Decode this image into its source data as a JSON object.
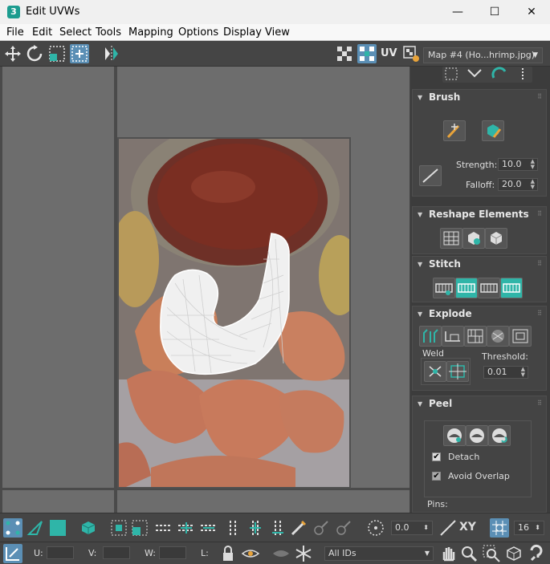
{
  "window": {
    "app_icon_text": "3",
    "title": "Edit UVWs",
    "minimize": "—",
    "maximize": "☐",
    "close": "✕"
  },
  "menu": [
    "File",
    "Edit",
    "Select",
    "Tools",
    "Mapping",
    "Options",
    "Display",
    "View"
  ],
  "toolbar": {
    "uv_label": "UV",
    "map_selected": "Map #4 (Ho...hrimp.jpg)"
  },
  "panel": {
    "brush": {
      "title": "Brush",
      "strength_label": "Strength:",
      "strength_value": "10.0",
      "falloff_label": "Falloff:",
      "falloff_value": "20.0"
    },
    "reshape": {
      "title": "Reshape Elements"
    },
    "stitch": {
      "title": "Stitch"
    },
    "explode": {
      "title": "Explode",
      "weld_label": "Weld",
      "threshold_label": "Threshold:",
      "threshold_value": "0.01"
    },
    "peel": {
      "title": "Peel",
      "detach_label": "Detach",
      "detach_checked": "✔",
      "avoid_overlap_label": "Avoid Overlap",
      "avoid_overlap_checked": "✔",
      "pins_label": "Pins:"
    }
  },
  "bottom": {
    "rotate_value": "0.0",
    "xy_label": "XY",
    "grid_value": "16",
    "u_label": "U:",
    "v_label": "V:",
    "w_label": "W:",
    "l_label": "L:",
    "ids_selected": "All IDs"
  },
  "colors": {
    "accent": "#2fb5a8",
    "panel_bg": "#3c3c3c",
    "viewport_bg": "#6d6d6d"
  }
}
